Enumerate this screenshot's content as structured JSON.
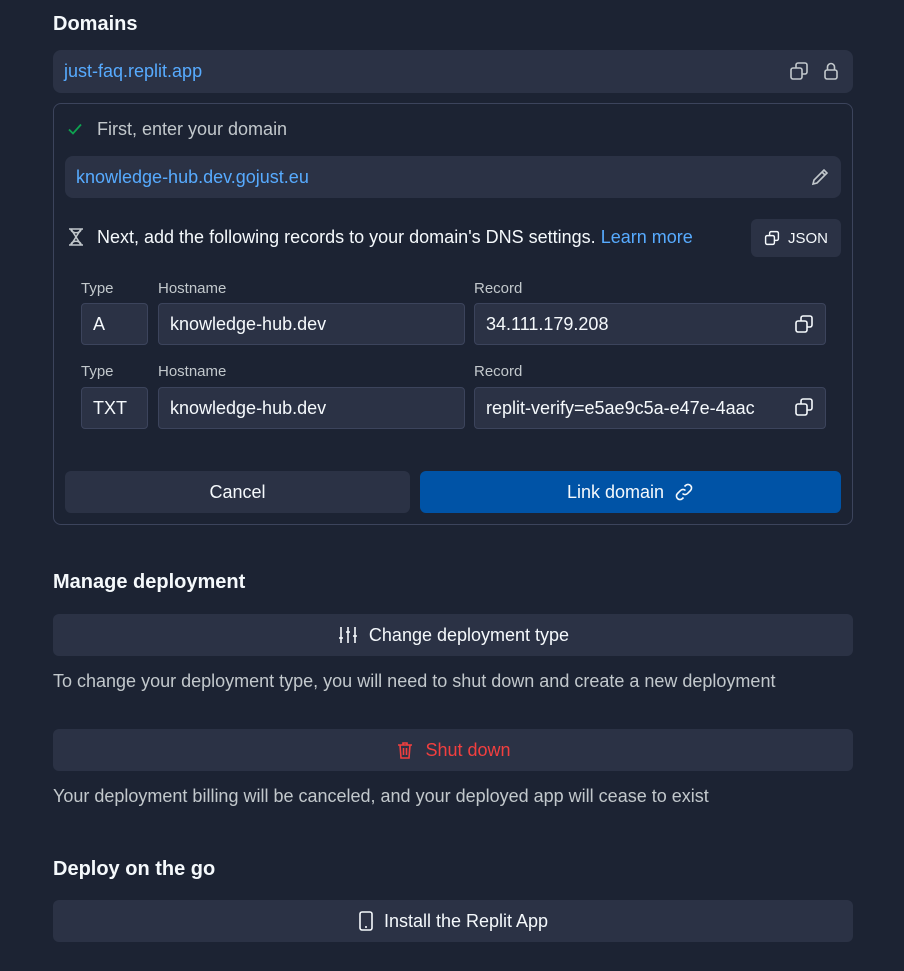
{
  "domains": {
    "title": "Domains",
    "current_domain": "just-faq.replit.app",
    "step1": {
      "label": "First, enter your domain",
      "domain_value": "knowledge-hub.dev.gojust.eu"
    },
    "step2": {
      "label": "Next, add the following records to your domain's DNS settings.",
      "learn_more": "Learn more",
      "json_button": "JSON"
    },
    "records": [
      {
        "type_label": "Type",
        "hostname_label": "Hostname",
        "record_label": "Record",
        "type": "A",
        "hostname": "knowledge-hub.dev",
        "record": "34.111.179.208"
      },
      {
        "type_label": "Type",
        "hostname_label": "Hostname",
        "record_label": "Record",
        "type": "TXT",
        "hostname": "knowledge-hub.dev",
        "record": "replit-verify=e5ae9c5a-e47e-4aac"
      }
    ],
    "cancel_button": "Cancel",
    "link_button": "Link domain"
  },
  "manage": {
    "title": "Manage deployment",
    "change_type_button": "Change deployment type",
    "change_type_note": "To change your deployment type, you will need to shut down and create a new deployment",
    "shutdown_button": "Shut down",
    "shutdown_note": "Your deployment billing will be canceled, and your deployed app will cease to exist"
  },
  "deploy_go": {
    "title": "Deploy on the go",
    "install_button": "Install the Replit App"
  },
  "colors": {
    "background": "#1c2333",
    "surface": "#2b3245",
    "link": "#57abff",
    "primary": "#0053a6",
    "danger": "#f23f3f",
    "success": "#0ea350"
  },
  "icons": [
    "copy-icon",
    "lock-icon",
    "check-icon",
    "pencil-icon",
    "hourglass-icon",
    "link-icon",
    "sliders-icon",
    "trash-icon",
    "phone-icon"
  ]
}
